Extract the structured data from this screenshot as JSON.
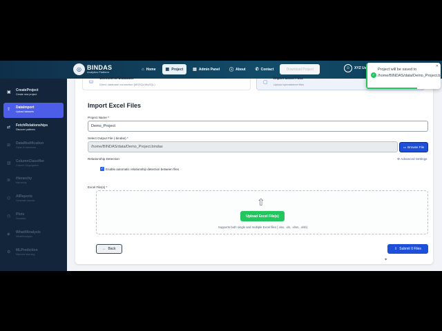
{
  "brand": {
    "name": "BINDAS",
    "tagline": "Analytics Platform"
  },
  "nav": [
    {
      "label": "Home",
      "icon": "⌂",
      "active": false
    },
    {
      "label": "Project",
      "icon": "▦",
      "active": true
    },
    {
      "label": "Admin Panel",
      "icon": "▤",
      "active": false
    },
    {
      "label": "About",
      "icon": "ⓘ",
      "active": false
    },
    {
      "label": "Contact",
      "icon": "✆",
      "active": false
    }
  ],
  "download_label": "Download Project",
  "user": {
    "label": "XYZ Us"
  },
  "sidebar": [
    {
      "title": "CreateProject",
      "sub": "Create new project",
      "icon": "▣"
    },
    {
      "title": "DataImport",
      "sub": "Upload datasets",
      "icon": "⇪"
    },
    {
      "title": "FetchRelationships",
      "sub": "Discover patterns",
      "icon": "⇄"
    },
    {
      "title": "DataModification",
      "sub": "Clean & transform",
      "icon": "⊞"
    },
    {
      "title": "ColumnClassifier",
      "sub": "Column Segregation",
      "icon": "▥"
    },
    {
      "title": "Hierarchy",
      "sub": "Hierarchy",
      "icon": "≣"
    },
    {
      "title": "AIReports",
      "sub": "Generate reports",
      "icon": "⌬"
    },
    {
      "title": "Plots",
      "sub": "Visualize",
      "icon": "◷"
    },
    {
      "title": "WhatIfAnalysis",
      "sub": "WhatIfAnalysis",
      "icon": "◈"
    },
    {
      "title": "MLPrediction",
      "sub": "Machine learning",
      "icon": "⚙"
    }
  ],
  "options": {
    "db": {
      "title": "Connect to Database",
      "sub": "Direct database connection (MSSQL/MySQL)"
    },
    "excel": {
      "title": "Import Excel Files",
      "sub": "Upload spreadsheet files"
    }
  },
  "form": {
    "heading": "Import Excel Files",
    "project_name_label": "Project Name *",
    "project_name_value": "Demo_Project",
    "output_label": "Select Output File (.bindas) *",
    "output_value": "/home/BINDAS/data/Demo_Project.bindas",
    "browse_label": "Browse File",
    "relationship_label": "Relationship Detection",
    "advanced_label": "Advanced Settings",
    "auto_detect_label": "Enable automatic relationship detection between files",
    "files_label": "Excel File(s) *",
    "upload_label": "Upload Excel File(s)",
    "upload_hint": "Supports both single and multiple Excel files (.xlsx, .xls, .xlsm, .xlsb)",
    "back_label": "Back",
    "submit_label": "Submit 0 Files"
  },
  "toast": {
    "message": "Project will be saved to /home/BINDAS/data/Demo_Project.bindas"
  }
}
